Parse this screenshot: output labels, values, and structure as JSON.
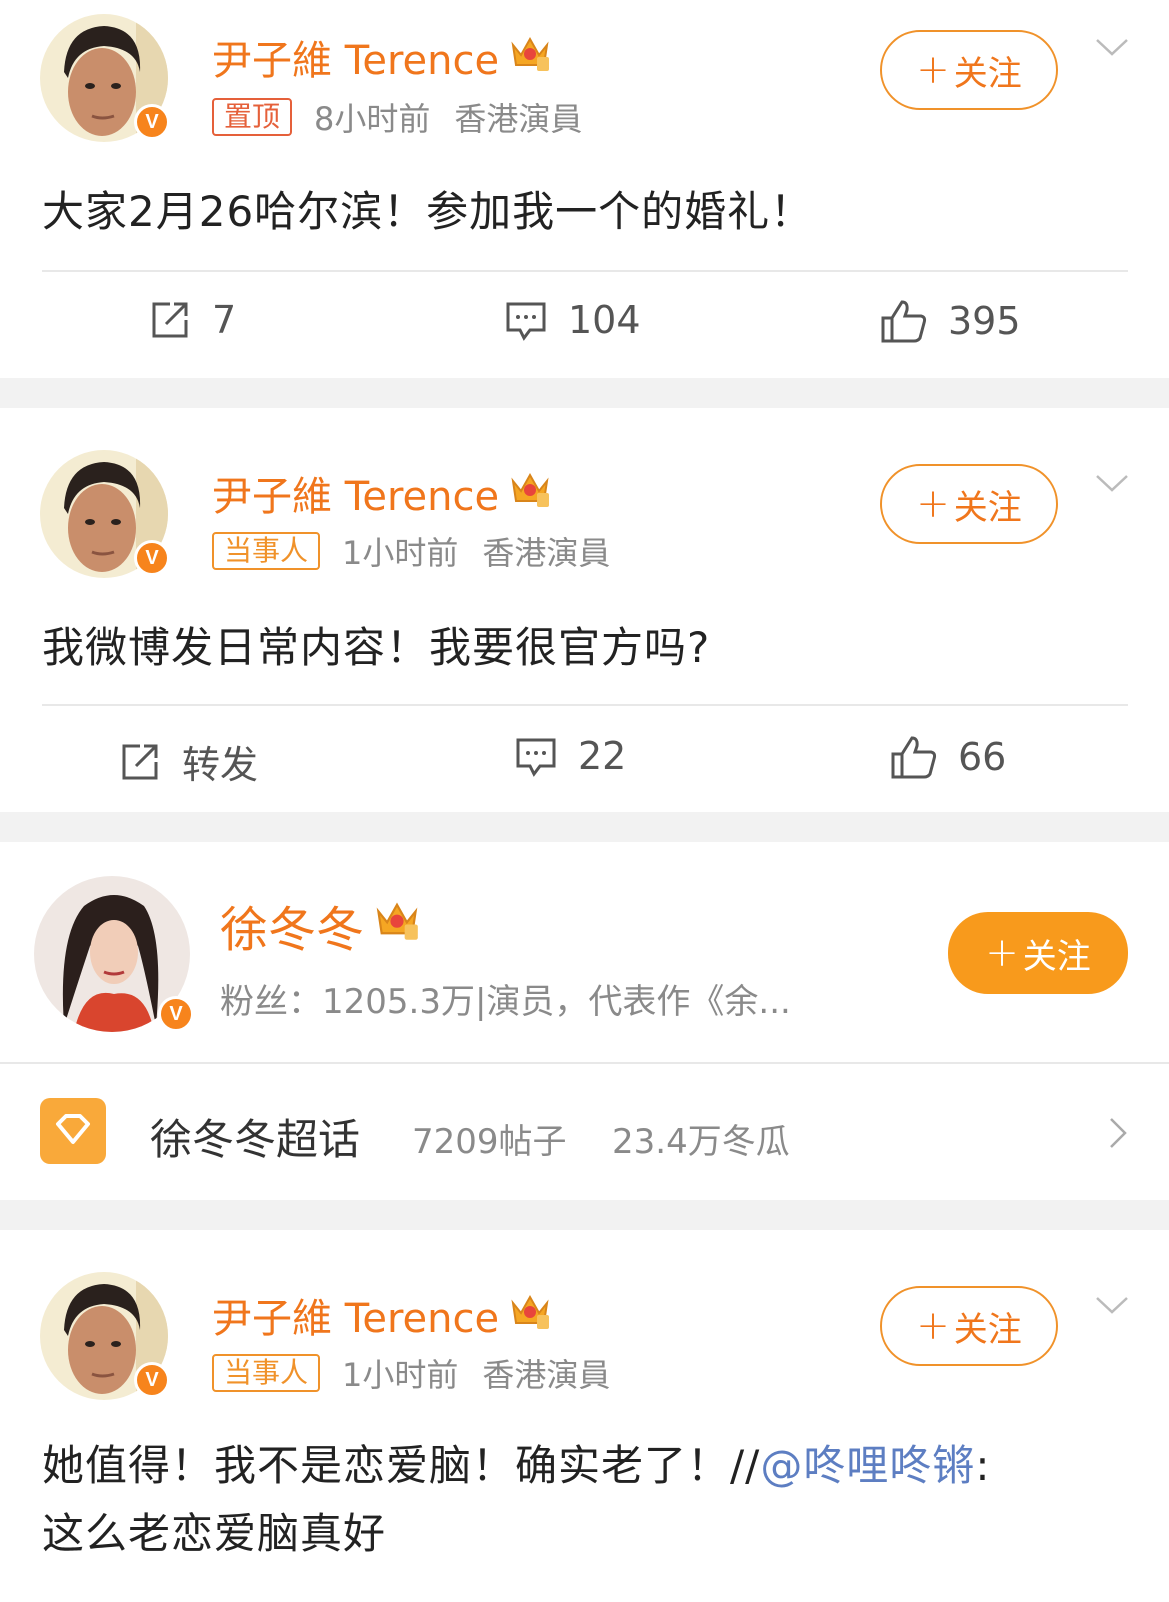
{
  "post1": {
    "author": "尹子維 Terence",
    "pin_tag": "置顶",
    "time": "8小时前",
    "source": "香港演員",
    "follow_label": "关注",
    "text": "大家2月26哈尔滨！参加我一个的婚礼！",
    "repost_count": "7",
    "comment_count": "104",
    "like_count": "395"
  },
  "post2": {
    "author": "尹子維 Terence",
    "party_tag": "当事人",
    "time": "1小时前",
    "source": "香港演員",
    "follow_label": "关注",
    "text": "我微博发日常内容！我要很官方吗?",
    "repost_label": "转发",
    "comment_count": "22",
    "like_count": "66"
  },
  "profile": {
    "name": "徐冬冬",
    "info": "粉丝：1205.3万|演员，代表作《余...",
    "follow_label": "关注",
    "supertopic_name": "徐冬冬超话",
    "supertopic_posts": "7209帖子",
    "supertopic_fans": "23.4万冬瓜"
  },
  "post3": {
    "author": "尹子維 Terence",
    "party_tag": "当事人",
    "time": "1小时前",
    "source": "香港演員",
    "follow_label": "关注",
    "text_line1_prefix": "她值得！我不是恋爱脑！确实老了！//",
    "mention": "@咚哩咚锵",
    "text_line1_suffix": ":",
    "text_line2": "这么老恋爱脑真好"
  },
  "icons": {
    "repost": "repost-icon",
    "comment": "comment-icon",
    "like": "thumbs-up-icon",
    "chevron": "chevron-down-icon",
    "crown": "crown-badge-icon",
    "verified": "verified-v-icon",
    "supertopic": "supertopic-diamond-icon"
  },
  "colors": {
    "accent": "#f0761c",
    "follow_fill": "#f89a1c",
    "mention": "#5d7ec2",
    "meta_gray": "#8a8a8a"
  }
}
